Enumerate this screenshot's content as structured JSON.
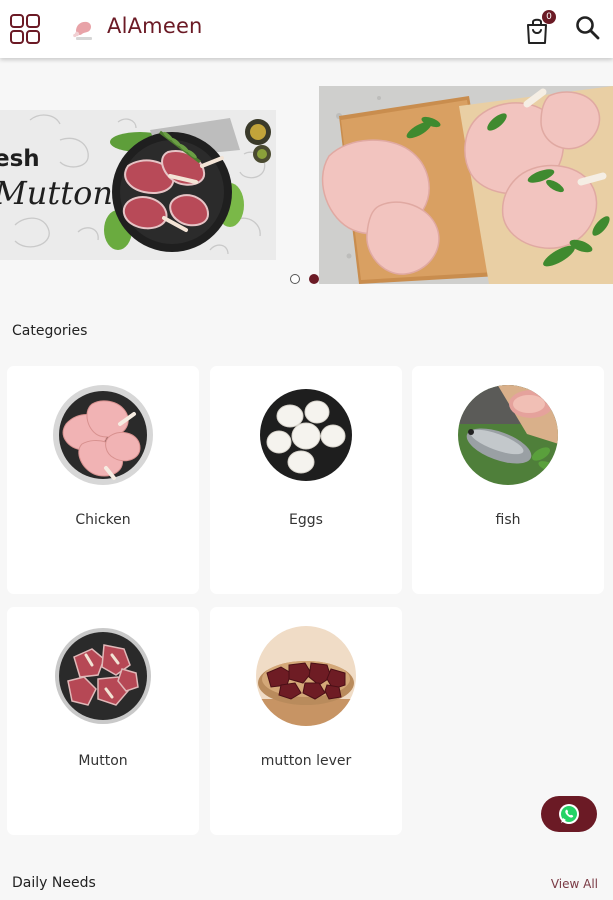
{
  "app": {
    "title": "AlAmeen",
    "brand_color": "#6b1a25"
  },
  "header": {
    "menu_icon": "grid-icon",
    "logo_icon": "meat-logo-icon",
    "cart_icon": "shopping-bag-icon",
    "cart_count": "0",
    "search_icon": "search-icon"
  },
  "banners": [
    {
      "line1": "esh",
      "line2": "Mutton"
    },
    {
      "image": "chicken-parts-banner"
    }
  ],
  "carousel": {
    "active_index": 1,
    "count": 2
  },
  "categories": {
    "title": "Categories",
    "items": [
      {
        "label": "Chicken"
      },
      {
        "label": "Eggs"
      },
      {
        "label": "fish"
      },
      {
        "label": "Mutton"
      },
      {
        "label": "mutton lever"
      }
    ]
  },
  "daily_needs": {
    "title": "Daily Needs",
    "view_all": "View All"
  },
  "whatsapp": {
    "icon": "whatsapp-icon"
  }
}
